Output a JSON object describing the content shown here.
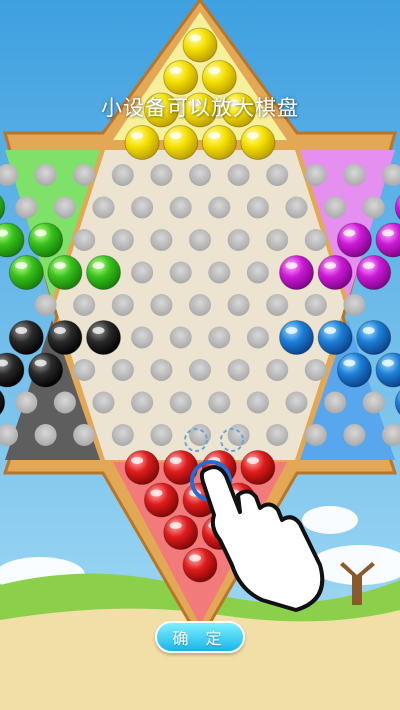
{
  "caption": "小设备可以放大棋盘",
  "confirm_label": "确 定",
  "colors": {
    "sky": "#7ec6ef",
    "grass": "#8ccf4b",
    "sand": "#f2dfa8",
    "board_frame": "#e2a855",
    "board_face": "#ece4d0",
    "hole": "#c9c9c9"
  },
  "pieces": {
    "top": "yellow",
    "upper_left": "green",
    "upper_right": "magenta",
    "lower_left": "black",
    "lower_right": "blue",
    "bottom": "red"
  },
  "icons": {
    "hand": "pointing-hand-icon",
    "selection": "selection-ring-icon"
  }
}
